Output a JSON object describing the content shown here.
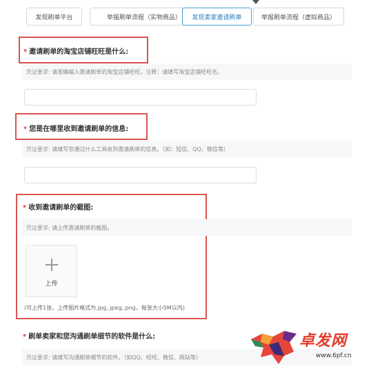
{
  "tabs": [
    {
      "label": "发现刷单平台"
    },
    {
      "label": "举报刷单流程（实物商品）"
    },
    {
      "label": "发现卖家邀请刷单"
    },
    {
      "label": "举报刷单流程（虚拟商品）"
    }
  ],
  "active_tab_index": 2,
  "required_mark": "*",
  "questions": [
    {
      "title": "邀请刷单的淘宝店铺旺旺是什么:",
      "hint_prefix": "凭证要求:",
      "hint_text": "请准确输入邀请刷单的淘宝店铺旺旺。注释：请填写淘宝店铺旺旺名。"
    },
    {
      "title": "您是在哪里收到邀请刷单的信息:",
      "hint_prefix": "凭证要求:",
      "hint_text": "请填写您通过什么工具收到邀请刷单的信息。（如：短信、QQ、微信等）"
    },
    {
      "title": "收到邀请刷单的截图:",
      "hint_prefix": "凭证要求:",
      "hint_text": "请上传邀请刷单的截图。",
      "upload_label": "上传",
      "upload_note": "(可上传1张，上传图片格式为.jpg,.jpeg,.png，每张大小5M以内)"
    },
    {
      "title": "刷单卖家和您沟通刷单细节的软件是什么:",
      "hint_prefix": "凭证要求:",
      "hint_text": "请填写沟通刷单细节的软件。（如QQ、旺旺、微信、网站等）"
    }
  ],
  "watermark": {
    "brand": "卓发网",
    "url": "www.6pf.cn"
  },
  "colors": {
    "highlight_box": "#d9534f",
    "required": "#e4393c",
    "active_tab": "#49a0d8",
    "hint_bg": "#f6f7f9"
  }
}
